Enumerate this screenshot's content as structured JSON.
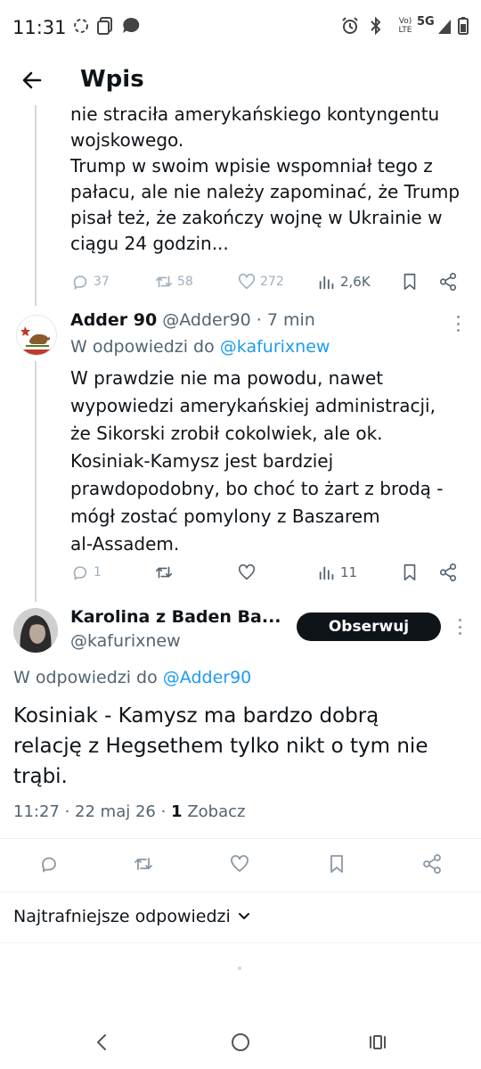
{
  "status_bar": {
    "time": "11:31",
    "volte_label": "Vo)\nLTE",
    "network_label": "5G",
    "icons": [
      "data-saver-icon",
      "screen-record-icon",
      "chat-bubble-icon",
      "alarm-icon",
      "bluetooth-icon",
      "volte-icon",
      "signal-icon",
      "battery-icon"
    ]
  },
  "header": {
    "title": "Wpis",
    "back_icon": "arrow-left-icon"
  },
  "tweet1": {
    "text_partial": "nie straciła amerykańskiego kontyngentu\nwojskowego.\nTrump w swoim wpisie wspomniał tego z\npałacu, ale nie należy zapominać, że Trump\npisał też, że zakończy wojnę w Ukrainie w\nciągu 24 godzin...",
    "replies": "37",
    "reposts": "58",
    "likes": "272",
    "views": "2,6K"
  },
  "tweet2": {
    "author_name": "Adder 90",
    "handle": "@Adder90",
    "time": "· 7 min",
    "reply_prefix": "W odpowiedzi do",
    "reply_to": "@kafurixnew",
    "text": "W prawdzie nie ma powodu, nawet\nwypowiedzi amerykańskiej administracji,\nże Sikorski zrobił cokolwiek, ale ok.\nKosiniak-Kamysz jest bardziej\nprawdopodobny, bo choć to żart z brodą -\nmógł zostać pomylony z Baszarem\nal-Assadem.",
    "replies": "1",
    "views": "11"
  },
  "main_tweet": {
    "author_name": "Karolina z Baden Ba...",
    "handle": "@kafurixnew",
    "follow_label": "Obserwuj",
    "reply_prefix": "W odpowiedzi do",
    "reply_to": "@Adder90",
    "text": "Kosiniak - Kamysz ma bardzo dobrą\nrelację z Hegsethem tylko nikt o tym nie\ntrąbi.",
    "timestamp": "11:27 · 22 maj 26 ·",
    "views_count": "1",
    "views_label": "Zobacz"
  },
  "sort": {
    "label": "Najtrafniejsze odpowiedzi"
  },
  "colors": {
    "accent": "#1d9bf0",
    "text": "#0f1419",
    "muted": "#536471",
    "follow_bg": "#0f1419"
  }
}
